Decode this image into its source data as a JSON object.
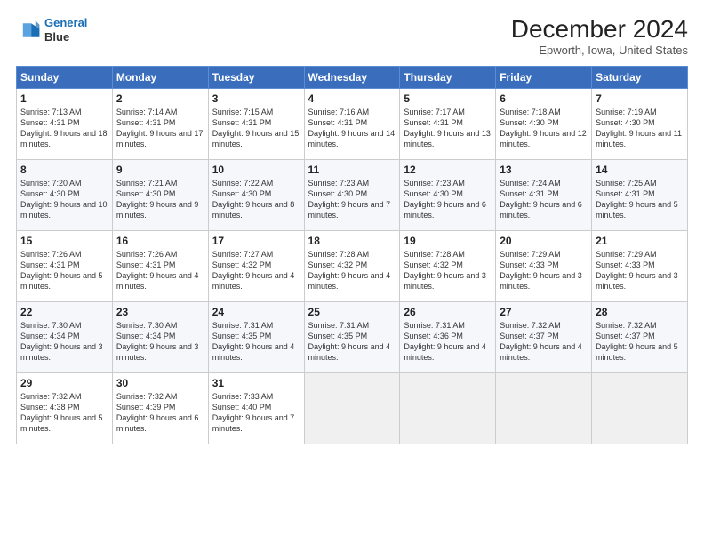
{
  "logo": {
    "line1": "General",
    "line2": "Blue"
  },
  "title": "December 2024",
  "location": "Epworth, Iowa, United States",
  "days_of_week": [
    "Sunday",
    "Monday",
    "Tuesday",
    "Wednesday",
    "Thursday",
    "Friday",
    "Saturday"
  ],
  "weeks": [
    [
      {
        "day": "1",
        "sunrise": "7:13 AM",
        "sunset": "4:31 PM",
        "daylight": "9 hours and 18 minutes."
      },
      {
        "day": "2",
        "sunrise": "7:14 AM",
        "sunset": "4:31 PM",
        "daylight": "9 hours and 17 minutes."
      },
      {
        "day": "3",
        "sunrise": "7:15 AM",
        "sunset": "4:31 PM",
        "daylight": "9 hours and 15 minutes."
      },
      {
        "day": "4",
        "sunrise": "7:16 AM",
        "sunset": "4:31 PM",
        "daylight": "9 hours and 14 minutes."
      },
      {
        "day": "5",
        "sunrise": "7:17 AM",
        "sunset": "4:31 PM",
        "daylight": "9 hours and 13 minutes."
      },
      {
        "day": "6",
        "sunrise": "7:18 AM",
        "sunset": "4:30 PM",
        "daylight": "9 hours and 12 minutes."
      },
      {
        "day": "7",
        "sunrise": "7:19 AM",
        "sunset": "4:30 PM",
        "daylight": "9 hours and 11 minutes."
      }
    ],
    [
      {
        "day": "8",
        "sunrise": "7:20 AM",
        "sunset": "4:30 PM",
        "daylight": "9 hours and 10 minutes."
      },
      {
        "day": "9",
        "sunrise": "7:21 AM",
        "sunset": "4:30 PM",
        "daylight": "9 hours and 9 minutes."
      },
      {
        "day": "10",
        "sunrise": "7:22 AM",
        "sunset": "4:30 PM",
        "daylight": "9 hours and 8 minutes."
      },
      {
        "day": "11",
        "sunrise": "7:23 AM",
        "sunset": "4:30 PM",
        "daylight": "9 hours and 7 minutes."
      },
      {
        "day": "12",
        "sunrise": "7:23 AM",
        "sunset": "4:30 PM",
        "daylight": "9 hours and 6 minutes."
      },
      {
        "day": "13",
        "sunrise": "7:24 AM",
        "sunset": "4:31 PM",
        "daylight": "9 hours and 6 minutes."
      },
      {
        "day": "14",
        "sunrise": "7:25 AM",
        "sunset": "4:31 PM",
        "daylight": "9 hours and 5 minutes."
      }
    ],
    [
      {
        "day": "15",
        "sunrise": "7:26 AM",
        "sunset": "4:31 PM",
        "daylight": "9 hours and 5 minutes."
      },
      {
        "day": "16",
        "sunrise": "7:26 AM",
        "sunset": "4:31 PM",
        "daylight": "9 hours and 4 minutes."
      },
      {
        "day": "17",
        "sunrise": "7:27 AM",
        "sunset": "4:32 PM",
        "daylight": "9 hours and 4 minutes."
      },
      {
        "day": "18",
        "sunrise": "7:28 AM",
        "sunset": "4:32 PM",
        "daylight": "9 hours and 4 minutes."
      },
      {
        "day": "19",
        "sunrise": "7:28 AM",
        "sunset": "4:32 PM",
        "daylight": "9 hours and 3 minutes."
      },
      {
        "day": "20",
        "sunrise": "7:29 AM",
        "sunset": "4:33 PM",
        "daylight": "9 hours and 3 minutes."
      },
      {
        "day": "21",
        "sunrise": "7:29 AM",
        "sunset": "4:33 PM",
        "daylight": "9 hours and 3 minutes."
      }
    ],
    [
      {
        "day": "22",
        "sunrise": "7:30 AM",
        "sunset": "4:34 PM",
        "daylight": "9 hours and 3 minutes."
      },
      {
        "day": "23",
        "sunrise": "7:30 AM",
        "sunset": "4:34 PM",
        "daylight": "9 hours and 3 minutes."
      },
      {
        "day": "24",
        "sunrise": "7:31 AM",
        "sunset": "4:35 PM",
        "daylight": "9 hours and 4 minutes."
      },
      {
        "day": "25",
        "sunrise": "7:31 AM",
        "sunset": "4:35 PM",
        "daylight": "9 hours and 4 minutes."
      },
      {
        "day": "26",
        "sunrise": "7:31 AM",
        "sunset": "4:36 PM",
        "daylight": "9 hours and 4 minutes."
      },
      {
        "day": "27",
        "sunrise": "7:32 AM",
        "sunset": "4:37 PM",
        "daylight": "9 hours and 4 minutes."
      },
      {
        "day": "28",
        "sunrise": "7:32 AM",
        "sunset": "4:37 PM",
        "daylight": "9 hours and 5 minutes."
      }
    ],
    [
      {
        "day": "29",
        "sunrise": "7:32 AM",
        "sunset": "4:38 PM",
        "daylight": "9 hours and 5 minutes."
      },
      {
        "day": "30",
        "sunrise": "7:32 AM",
        "sunset": "4:39 PM",
        "daylight": "9 hours and 6 minutes."
      },
      {
        "day": "31",
        "sunrise": "7:33 AM",
        "sunset": "4:40 PM",
        "daylight": "9 hours and 7 minutes."
      },
      null,
      null,
      null,
      null
    ]
  ]
}
